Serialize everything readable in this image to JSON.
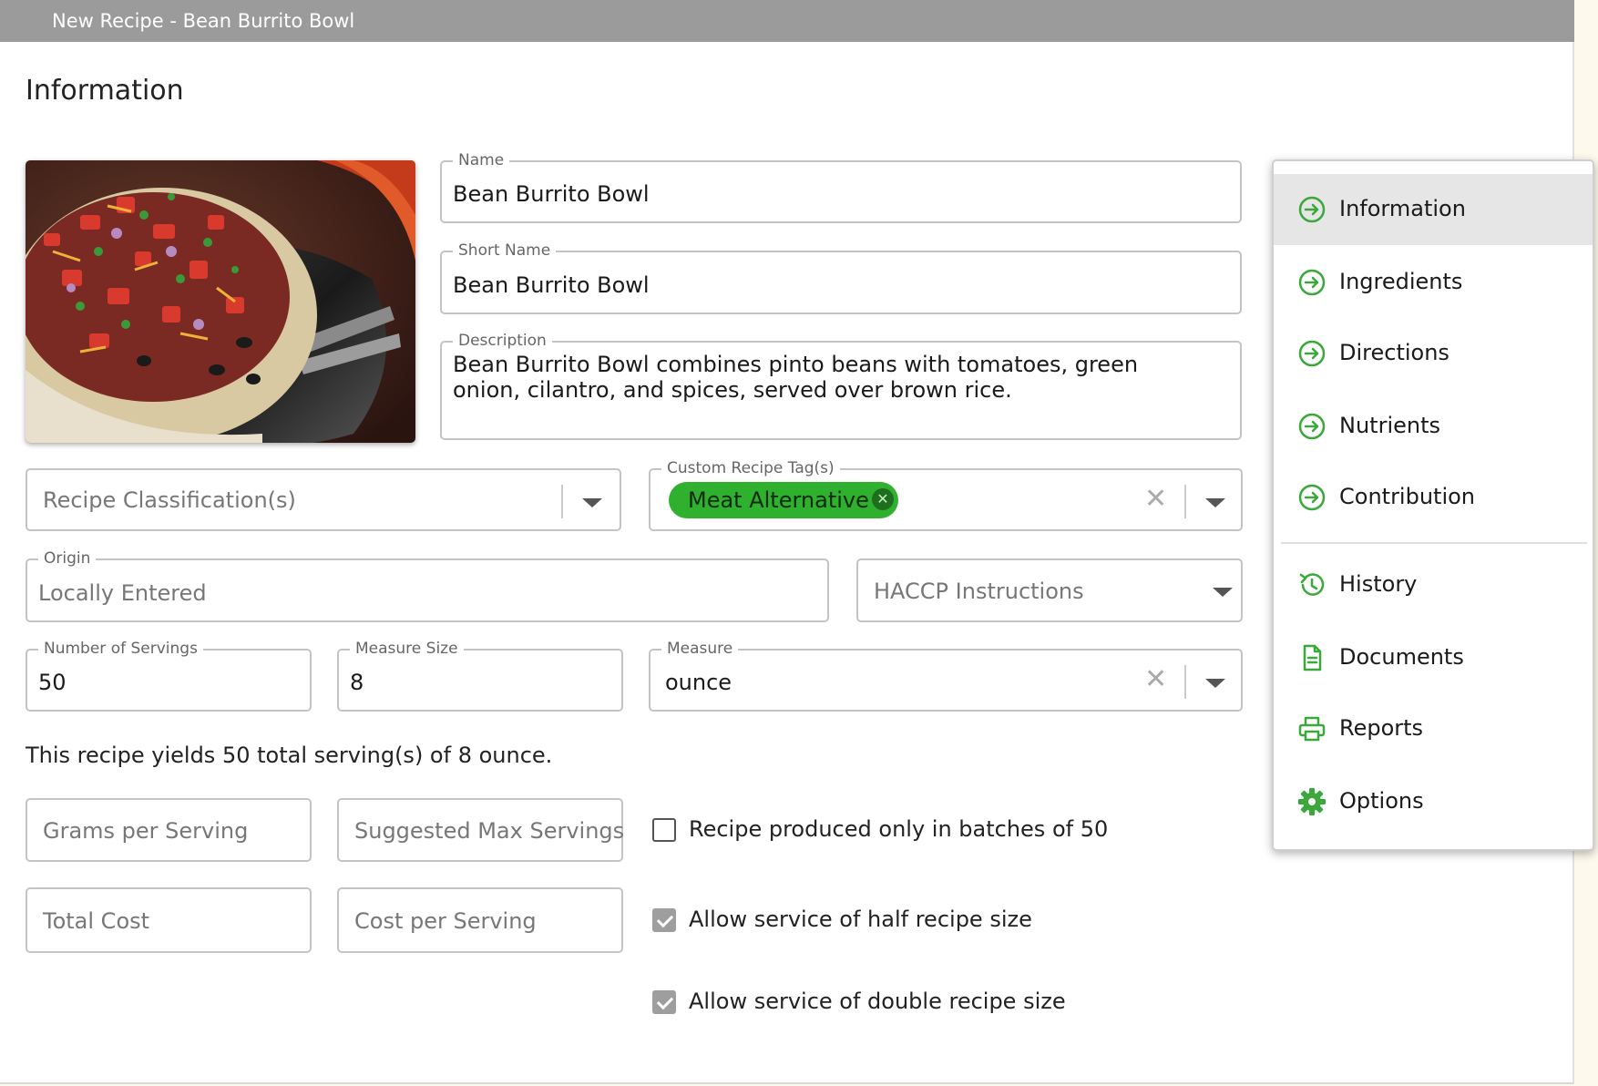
{
  "window": {
    "title": "New Recipe - Bean Burrito Bowl"
  },
  "section_title": "Information",
  "form": {
    "name": {
      "label": "Name",
      "value": "Bean Burrito Bowl"
    },
    "short_name": {
      "label": "Short Name",
      "value": "Bean Burrito Bowl"
    },
    "description": {
      "label": "Description",
      "value": "Bean Burrito Bowl combines pinto beans with tomatoes, green onion, cilantro, and spices, served over brown rice."
    },
    "classification": {
      "placeholder": "Recipe Classification(s)"
    },
    "custom_tags": {
      "label": "Custom Recipe Tag(s)",
      "chips": [
        "Meat Alternative"
      ]
    },
    "origin": {
      "label": "Origin",
      "value": "Locally Entered"
    },
    "haccp": {
      "placeholder": "HACCP Instructions"
    },
    "servings": {
      "label": "Number of Servings",
      "value": "50"
    },
    "measure_size": {
      "label": "Measure Size",
      "value": "8"
    },
    "measure": {
      "label": "Measure",
      "value": "ounce"
    },
    "yield_text": "This recipe yields 50 total serving(s) of 8 ounce.",
    "grams_per_serving": {
      "placeholder": "Grams per Serving"
    },
    "suggested_max": {
      "placeholder": "Suggested Max Servings"
    },
    "total_cost": {
      "placeholder": "Total Cost"
    },
    "cost_per_serving": {
      "placeholder": "Cost per Serving"
    },
    "checkboxes": [
      {
        "label": "Recipe produced only in batches of 50",
        "checked": false
      },
      {
        "label": "Allow service of half recipe size",
        "checked": true
      },
      {
        "label": "Allow service of double recipe size",
        "checked": true
      }
    ]
  },
  "nav": {
    "items": [
      {
        "label": "Information",
        "icon": "arrow-circle-right-icon",
        "active": true
      },
      {
        "label": "Ingredients",
        "icon": "arrow-circle-right-icon"
      },
      {
        "label": "Directions",
        "icon": "arrow-circle-right-icon"
      },
      {
        "label": "Nutrients",
        "icon": "arrow-circle-right-icon"
      },
      {
        "label": "Contribution",
        "icon": "arrow-circle-right-icon"
      },
      {
        "label": "History",
        "icon": "history-icon"
      },
      {
        "label": "Documents",
        "icon": "document-icon"
      },
      {
        "label": "Reports",
        "icon": "printer-icon"
      },
      {
        "label": "Options",
        "icon": "gear-icon"
      }
    ]
  },
  "colors": {
    "accent": "#2fb12f",
    "titlebar": "#9b9b9b",
    "nav_icon": "#3aa83a"
  }
}
